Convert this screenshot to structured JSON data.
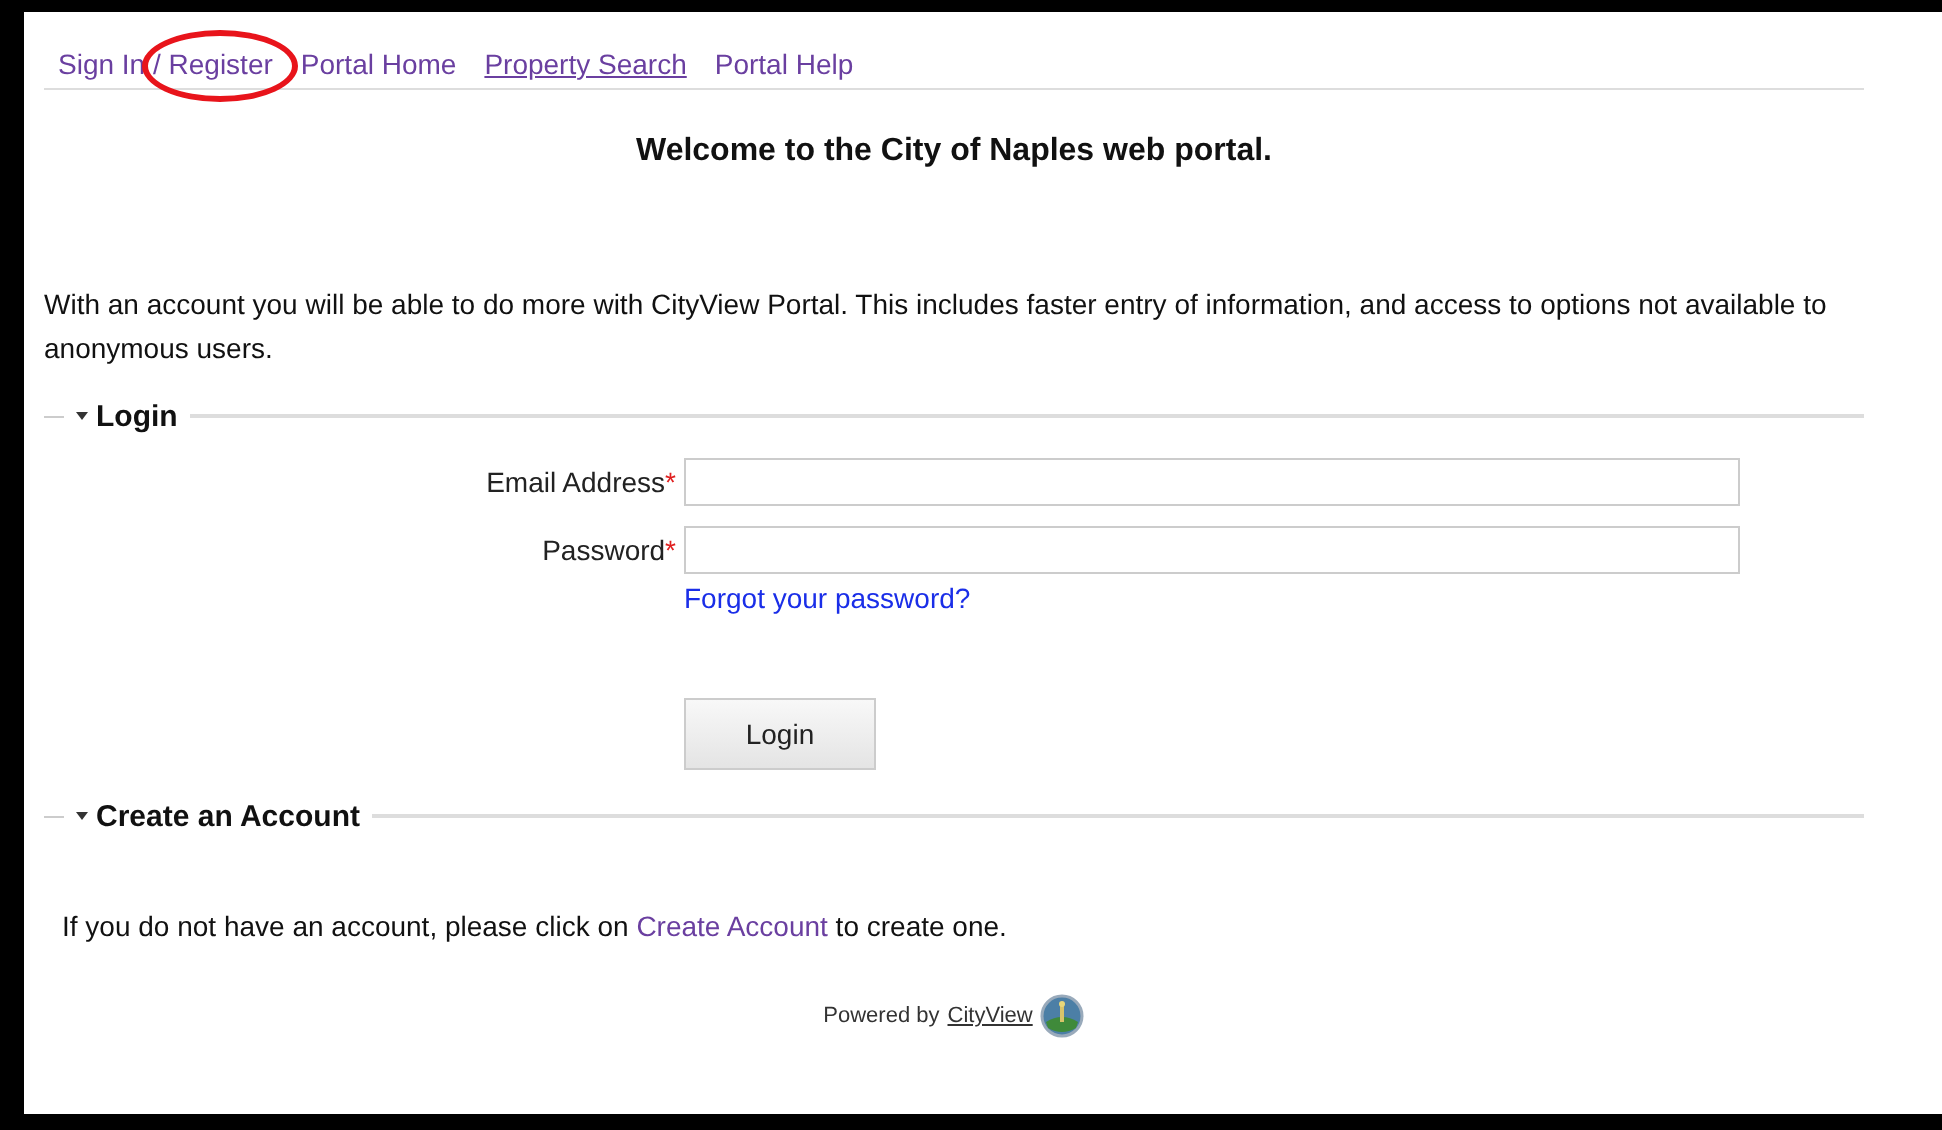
{
  "nav": [
    {
      "label": "Sign In / Register",
      "underlined": false
    },
    {
      "label": "Portal Home",
      "underlined": false
    },
    {
      "label": "Property Search",
      "underlined": true
    },
    {
      "label": "Portal Help",
      "underlined": false
    }
  ],
  "annotation": {
    "kind": "ellipse",
    "color": "#e8141b"
  },
  "title": "Welcome to the City of Naples web portal.",
  "intro": "With an account you will be able to do more with CityView Portal. This includes faster entry of information, and access to options not available to anonymous users.",
  "login": {
    "legend": "Login",
    "expanded": true,
    "fields": [
      {
        "label": "Email Address",
        "required": true,
        "required_mark": "*"
      },
      {
        "label": "Password",
        "required": true,
        "required_mark": "*"
      }
    ],
    "forgot_link": "Forgot your password?",
    "button": "Login"
  },
  "create_account": {
    "legend": "Create an Account",
    "expanded": true,
    "text_before": "If you do not have an account, please click on",
    "link": "Create Account",
    "text_after": "to create one."
  },
  "footer": {
    "powered_by": "Powered by",
    "brand_link": "CityView"
  }
}
